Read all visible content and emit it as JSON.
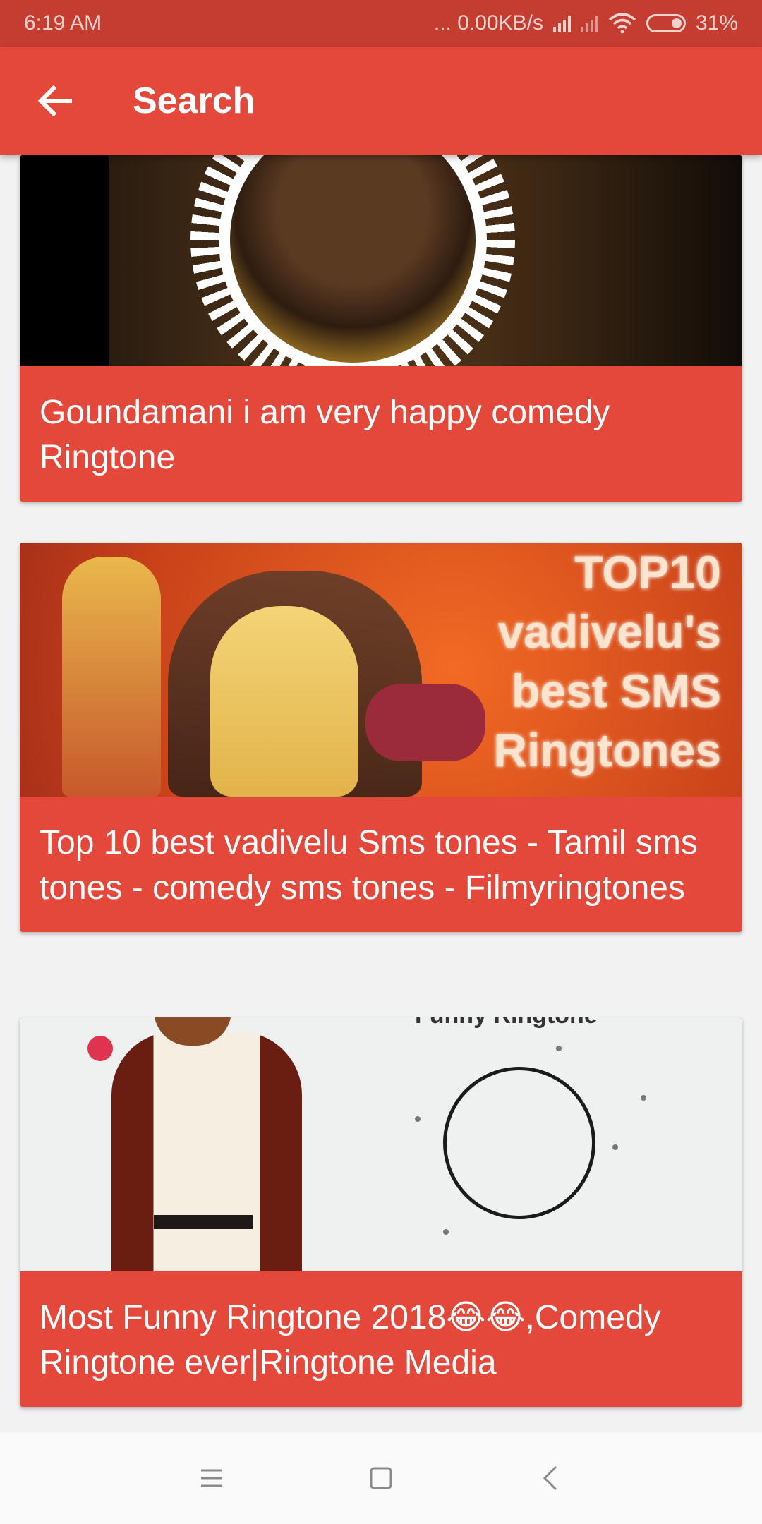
{
  "status_bar": {
    "time": "6:19 AM",
    "network_speed": "... 0.00KB/s",
    "battery": "31%",
    "icons": [
      "signal-icon",
      "signal-icon",
      "wifi-icon",
      "battery-icon"
    ]
  },
  "app_bar": {
    "title": "Search",
    "back_icon": "arrow-left-icon"
  },
  "results": [
    {
      "title": "Goundamani  i am very happy comedy Ringtone"
    },
    {
      "title": "Top 10 best vadivelu Sms tones - Tamil sms tones - comedy sms tones - Filmyringtones",
      "thumbnail_text": [
        "TOP10",
        "vadivelu's",
        "best SMS",
        "Ringtones"
      ]
    },
    {
      "title": "Most Funny Ringtone 2018😂😂,Comedy Ringtone ever|Ringtone Media",
      "thumbnail_text": "Funny Ringtone"
    }
  ],
  "nav_bar": {
    "icons": [
      "menu-icon",
      "home-icon",
      "back-icon"
    ]
  },
  "colors": {
    "primary": "#e4483b",
    "status_bar": "#c43d30"
  }
}
